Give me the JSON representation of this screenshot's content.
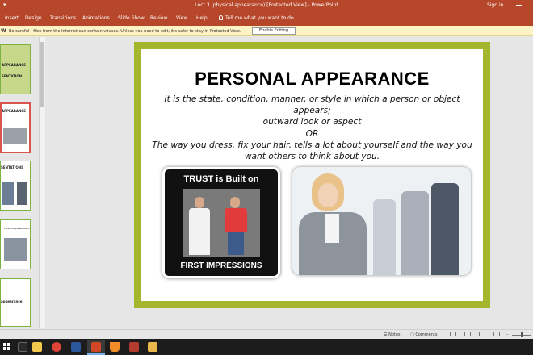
{
  "titlebar": {
    "doc_title": "Lect 3 (physical appearance) [Protected View]  -  PowerPoint",
    "sign_in": "Sign in"
  },
  "ribbon": {
    "tabs": [
      "Insert",
      "Design",
      "Transitions",
      "Animations",
      "Slide Show",
      "Review",
      "View",
      "Help"
    ],
    "tell_me": "Tell me what you want to do"
  },
  "protected_view": {
    "message": "Be careful—files from the Internet can contain viruses. Unless you need to edit, it's safer to stay in Protected View.",
    "button": "Enable Editing"
  },
  "thumbnails": [
    {
      "line1": "APPEARANCE",
      "line2": "SENTATION"
    },
    {
      "line1": "APPEARANCE"
    },
    {
      "line1": "SENTATIONS"
    },
    {
      "line1": "Personal presentation"
    },
    {
      "line1": "appearance"
    }
  ],
  "slide": {
    "title": "PERSONAL APPEARANCE",
    "line1": "It is the state, condition, manner, or style in which a person or object appears;",
    "line2": "outward look or aspect",
    "line3": "OR",
    "line4": "The way you dress, fix your hair, tells a lot about yourself and the way you",
    "line5": "want others to think about you.",
    "image1_top": "TRUST is Built on",
    "image1_bottom": "FIRST IMPRESSIONS"
  },
  "statusbar": {
    "notes": "Notes",
    "comments": "Comments"
  },
  "colors": {
    "accent": "#b7472a",
    "slide_border": "#a4b62e",
    "warning_bar": "#fdf3c5"
  }
}
